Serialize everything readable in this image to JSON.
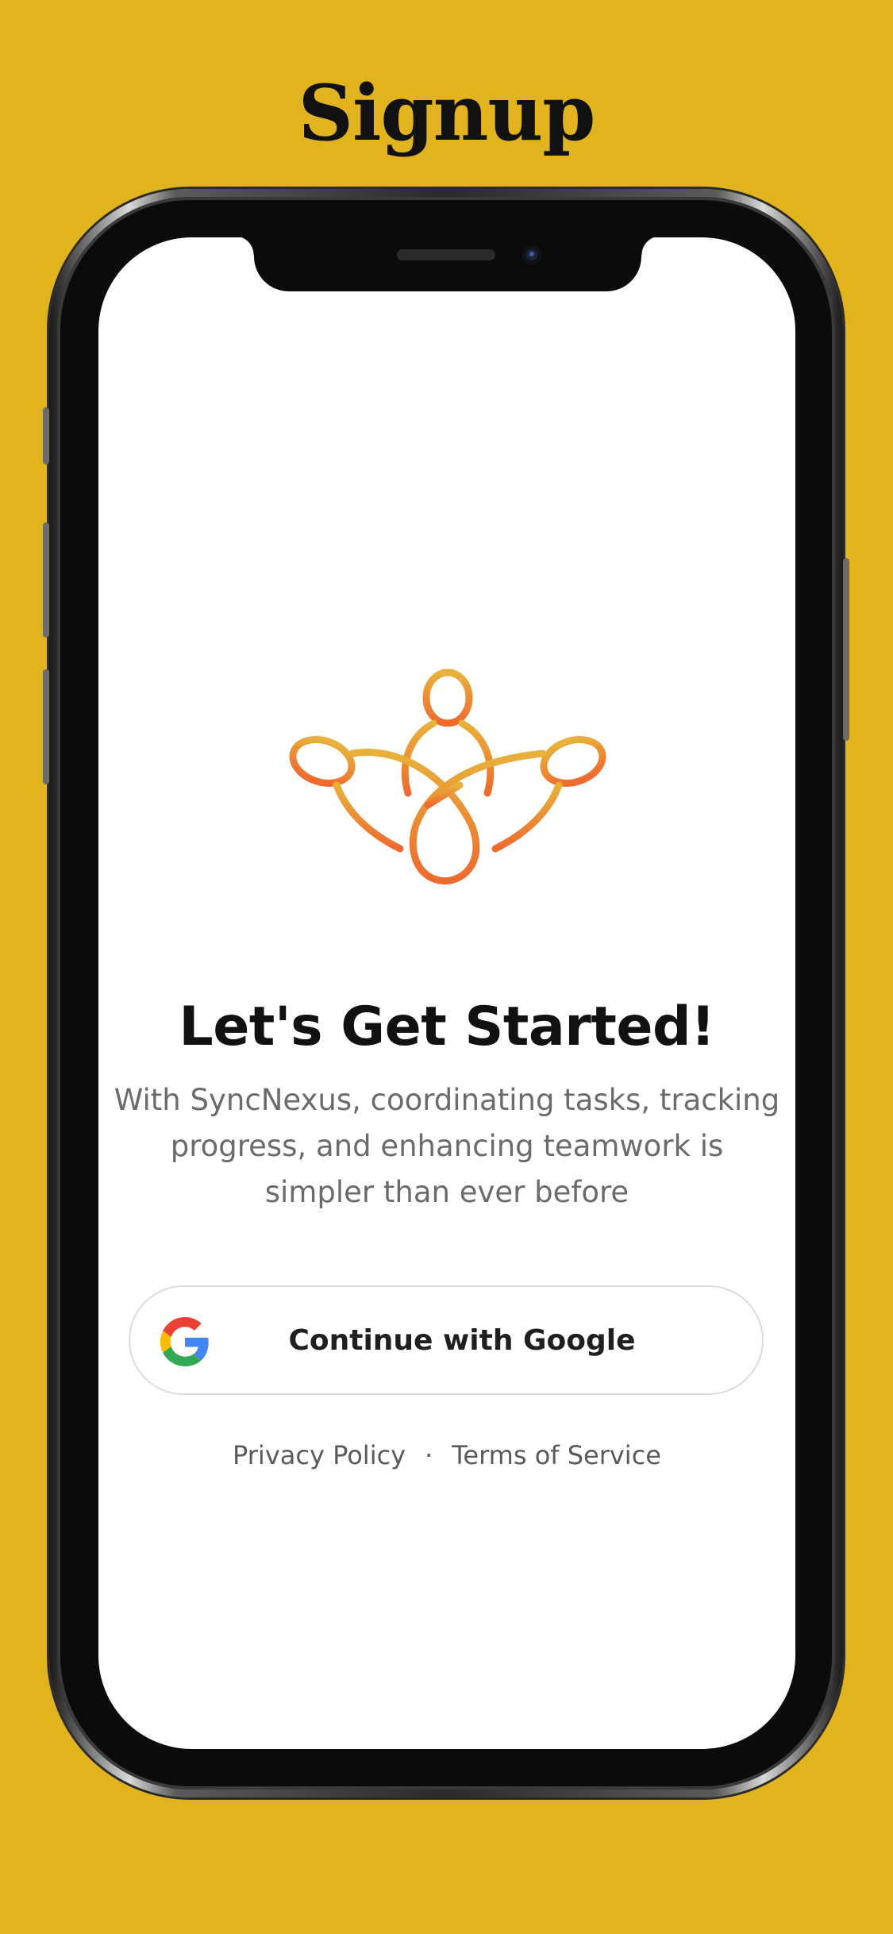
{
  "page": {
    "title": "Signup",
    "background_color": "#E1B41F"
  },
  "screen": {
    "logo_icon": "meditation-figure-logo",
    "headline": "Let's Get Started!",
    "subtitle": "With SyncNexus, coordinating tasks, tracking progress, and enhancing teamwork is simpler than ever before",
    "google_button": {
      "label": "Continue with Google",
      "icon": "google-g-icon"
    },
    "links": {
      "privacy": "Privacy Policy",
      "separator": "·",
      "terms": "Terms of Service"
    }
  },
  "colors": {
    "logo_gradient_start": "#E8B23A",
    "logo_gradient_end": "#EE6A2E"
  }
}
